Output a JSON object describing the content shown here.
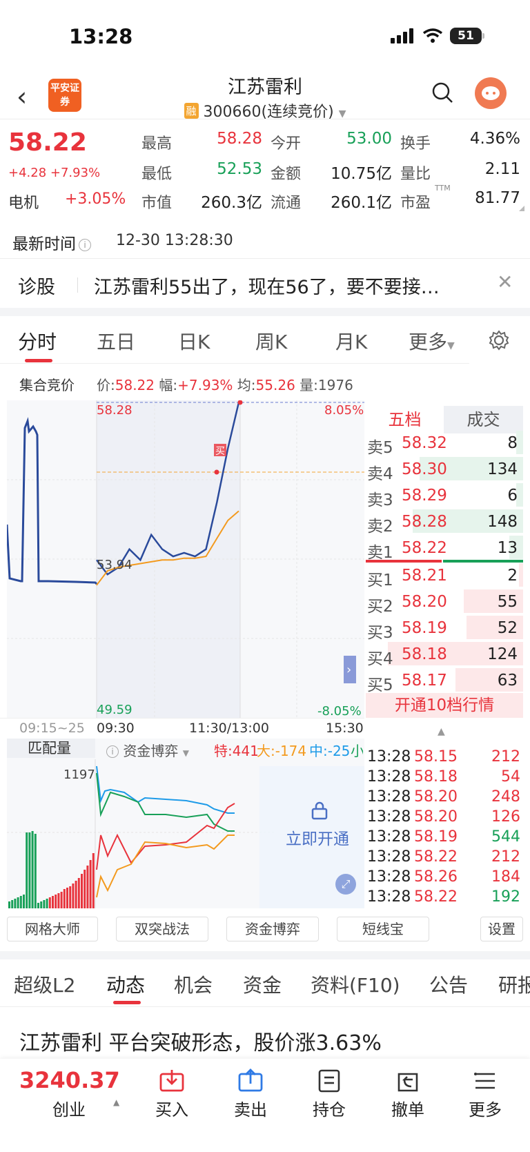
{
  "status": {
    "time": "13:28",
    "battery": "51"
  },
  "header": {
    "back": "‹",
    "logo_text": "平安证券",
    "title": "江苏雷利",
    "rong": "融",
    "code": "300660(连续竞价)"
  },
  "quote": {
    "price": "58.22",
    "change": "+4.28 +7.93%",
    "sector": "电机",
    "sector_pct": "+3.05%",
    "fields": [
      {
        "label": "最高",
        "value": "58.28",
        "color": "red"
      },
      {
        "label": "今开",
        "value": "53.00",
        "color": "green"
      },
      {
        "label": "换手",
        "value": "4.36%",
        "color": "black"
      },
      {
        "label": "最低",
        "value": "52.53",
        "color": "green"
      },
      {
        "label": "金额",
        "value": "10.75亿",
        "color": "black"
      },
      {
        "label": "量比",
        "value": "2.11",
        "color": "black"
      },
      {
        "label": "市值",
        "value": "260.3亿",
        "color": "black"
      },
      {
        "label": "流通",
        "value": "260.1亿",
        "color": "black"
      },
      {
        "label": "市盈",
        "value": "81.77",
        "color": "black"
      }
    ],
    "pe_sup": "TTM"
  },
  "latest": {
    "label": "最新时间",
    "ts": "12-30 13:28:30"
  },
  "diagnosis": {
    "label": "诊股",
    "text": "江苏雷利55出了，现在56了，要不要接…",
    "close": "✕"
  },
  "chart_tabs": [
    "分时",
    "五日",
    "日K",
    "周K",
    "月K",
    "更多"
  ],
  "auction": {
    "label": "集合竞价",
    "price_label": "价:",
    "price": "58.22",
    "amp_label": "幅:",
    "amp": "+7.93%",
    "avg_label": "均:",
    "avg": "55.26",
    "vol_label": "量:",
    "vol": "1976"
  },
  "chart": {
    "high": "58.28",
    "high_pct": "8.05%",
    "low": "49.59",
    "low_pct": "-8.05%",
    "mid": "53.94",
    "buy_mark": "买",
    "x_labels": [
      "09:15~25",
      "09:30",
      "11:30/13:00",
      "15:30"
    ]
  },
  "chart_data": {
    "type": "line",
    "title": "",
    "xlabel": "",
    "ylabel": "",
    "ylim": [
      49.59,
      58.28
    ],
    "series": [
      {
        "name": "价",
        "values": [
          53.9,
          53.5,
          53.7,
          54.2,
          53.9,
          54.6,
          54.2,
          54.0,
          54.1,
          54.0,
          54.2,
          55.5,
          57.0,
          58.28
        ]
      },
      {
        "name": "均",
        "values": [
          53.2,
          53.6,
          53.7,
          53.75,
          53.8,
          53.85,
          53.9,
          53.9,
          53.95,
          53.95,
          54.0,
          54.5,
          55.0,
          55.26
        ]
      }
    ]
  },
  "orderbook": {
    "tabs": [
      "五档",
      "成交"
    ],
    "sells": [
      {
        "label": "卖5",
        "price": "58.32",
        "vol": "8"
      },
      {
        "label": "卖4",
        "price": "58.30",
        "vol": "134"
      },
      {
        "label": "卖3",
        "price": "58.29",
        "vol": "6"
      },
      {
        "label": "卖2",
        "price": "58.28",
        "vol": "148"
      },
      {
        "label": "卖1",
        "price": "58.22",
        "vol": "13"
      }
    ],
    "buys": [
      {
        "label": "买1",
        "price": "58.21",
        "vol": "2"
      },
      {
        "label": "买2",
        "price": "58.20",
        "vol": "55"
      },
      {
        "label": "买3",
        "price": "58.19",
        "vol": "52"
      },
      {
        "label": "买4",
        "price": "58.18",
        "vol": "124"
      },
      {
        "label": "买5",
        "price": "58.17",
        "vol": "63"
      }
    ],
    "open10": "开通10档行情"
  },
  "ticks": [
    {
      "t": "13:28",
      "p": "58.15",
      "v": "212",
      "c": "red"
    },
    {
      "t": "13:28",
      "p": "58.18",
      "v": "54",
      "c": "red"
    },
    {
      "t": "13:28",
      "p": "58.20",
      "v": "248",
      "c": "red"
    },
    {
      "t": "13:28",
      "p": "58.20",
      "v": "126",
      "c": "red"
    },
    {
      "t": "13:28",
      "p": "58.19",
      "v": "544",
      "c": "green"
    },
    {
      "t": "13:28",
      "p": "58.22",
      "v": "212",
      "c": "red"
    },
    {
      "t": "13:28",
      "p": "58.26",
      "v": "184",
      "c": "red"
    },
    {
      "t": "13:28",
      "p": "58.22",
      "v": "192",
      "c": "green"
    }
  ],
  "subchart": {
    "label": "匹配量",
    "mode": "资金博弈",
    "te": "特:441",
    "da": "大:-174",
    "zhong": "中:-25",
    "xiao": "小",
    "level": "1197",
    "unlock": "立即开通"
  },
  "tools": [
    "网格大师",
    "双突战法",
    "资金博弈",
    "短线宝",
    "设置"
  ],
  "news_tabs": [
    "超级L2",
    "动态",
    "机会",
    "资金",
    "资料(F10)",
    "公告",
    "研报"
  ],
  "news": {
    "headline": "江苏雷利 平台突破形态，股价涨3.63%"
  },
  "bottom": {
    "index": "3240.37",
    "index_name": "创业",
    "items": [
      "买入",
      "卖出",
      "持仓",
      "撤单",
      "更多"
    ]
  },
  "colors": {
    "red": "#e8333c",
    "green": "#18a058",
    "blue": "#2a4a9b",
    "orange": "#f39a1e"
  }
}
